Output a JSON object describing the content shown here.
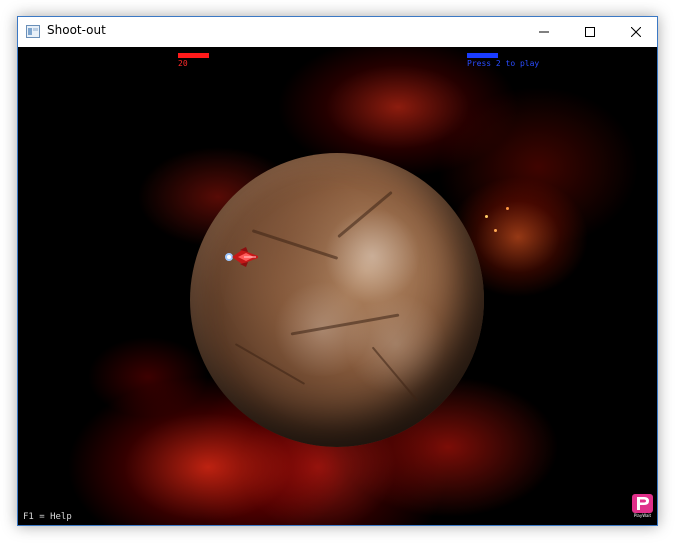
{
  "window": {
    "title": "Shoot-out"
  },
  "hud": {
    "player1_score": "20",
    "player2_prompt": "Press 2 to play",
    "help_text": "F1 = Help"
  },
  "logo": {
    "text": "PlayWait"
  },
  "colors": {
    "player1": "#ff1a1a",
    "player2": "#1a3cff",
    "titlebar_border": "#3b78c4"
  },
  "icons": [
    "app-icon",
    "minimize-icon",
    "maximize-icon",
    "close-icon",
    "spaceship-icon",
    "playwait-logo-icon"
  ]
}
